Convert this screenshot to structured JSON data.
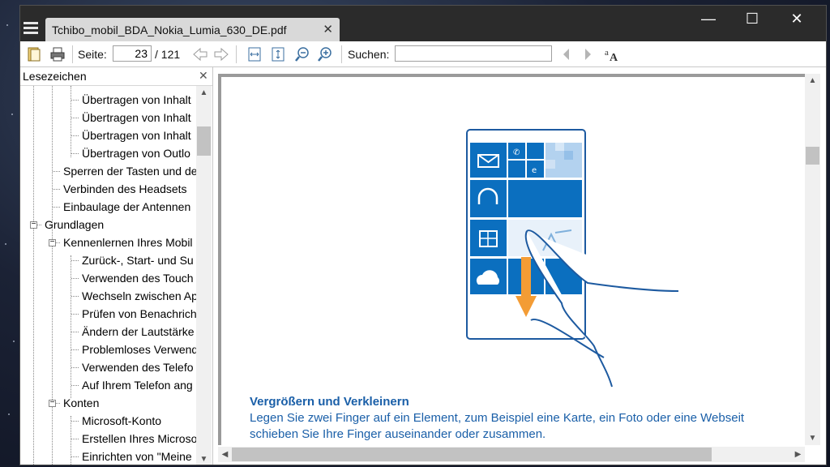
{
  "window": {
    "tab_title": "Tchibo_mobil_BDA_Nokia_Lumia_630_DE.pdf",
    "tab_close": "✕",
    "minimize": "—",
    "maximize": "☐",
    "close": "✕"
  },
  "toolbar": {
    "page_label": "Seite:",
    "page_value": "23",
    "page_total": "/ 121",
    "search_label": "Suchen:",
    "search_value": ""
  },
  "sidebar": {
    "title": "Lesezeichen",
    "close": "✕",
    "items": [
      {
        "label": "Übertragen von Inhalt",
        "level": 3
      },
      {
        "label": "Übertragen von Inhalt",
        "level": 3
      },
      {
        "label": "Übertragen von Inhalt",
        "level": 3
      },
      {
        "label": "Übertragen von Outlo",
        "level": 3
      },
      {
        "label": "Sperren der Tasten und de",
        "level": 2
      },
      {
        "label": "Verbinden des Headsets",
        "level": 2
      },
      {
        "label": "Einbaulage der Antennen",
        "level": 2
      },
      {
        "label": "Grundlagen",
        "level": 1
      },
      {
        "label": "Kennenlernen Ihres Mobil",
        "level": 2
      },
      {
        "label": "Zurück-, Start- und Su",
        "level": 3
      },
      {
        "label": "Verwenden des Touch",
        "level": 3
      },
      {
        "label": "Wechseln zwischen Ap",
        "level": 3
      },
      {
        "label": "Prüfen von Benachrich",
        "level": 3
      },
      {
        "label": "Ändern der Lautstärke",
        "level": 3
      },
      {
        "label": "Problemloses Verwend",
        "level": 3
      },
      {
        "label": "Verwenden des Telefo",
        "level": 3
      },
      {
        "label": "Auf Ihrem Telefon ang",
        "level": 3
      },
      {
        "label": "Konten",
        "level": 2
      },
      {
        "label": "Microsoft-Konto",
        "level": 3
      },
      {
        "label": "Erstellen Ihres Microso",
        "level": 3
      },
      {
        "label": "Einrichten von \"Meine",
        "level": 3
      }
    ]
  },
  "document": {
    "heading": "Vergrößern und Verkleinern",
    "line1": "Legen Sie zwei Finger auf ein Element, zum Beispiel eine Karte, ein Foto oder eine Webseit",
    "line2": "schieben Sie Ihre Finger auseinander oder zusammen."
  },
  "colors": {
    "titlebar": "#2b2b2b",
    "tile_blue": "#0b6fbf",
    "doc_text": "#1a5fa8",
    "arrow": "#f39c35"
  }
}
